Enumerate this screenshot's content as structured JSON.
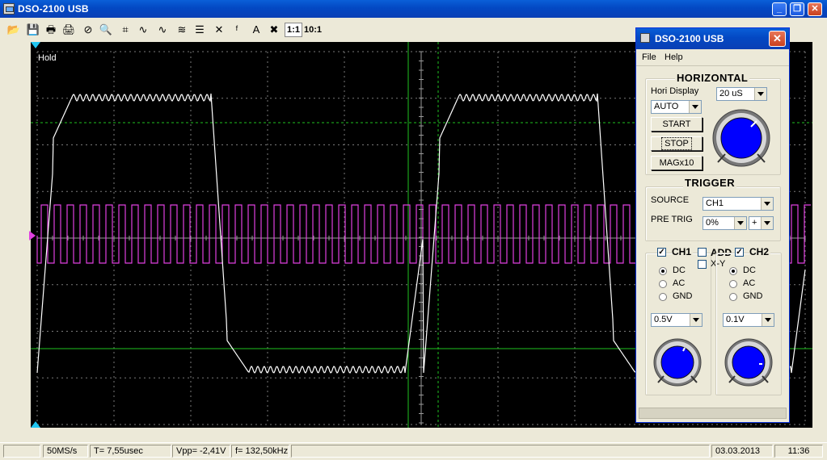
{
  "window": {
    "title": "DSO-2100 USB"
  },
  "toolbar": {
    "icons": [
      "open-icon",
      "save-icon",
      "print-icon",
      "printer-setup-icon",
      "stop-icon",
      "zoom-icon",
      "cursor-icon",
      "sine-icon",
      "sine-alt-icon",
      "math-icon",
      "grid-icon",
      "marker-icon",
      "fft-icon",
      "auto-icon",
      "clear-icon"
    ],
    "probe_1x": "1:1",
    "probe_10x": "10:1"
  },
  "screen": {
    "hold_label": "Hold",
    "colors": {
      "ch1": "#FFFFFF",
      "ch2": "#E040E0",
      "grid": "#7a7a7a",
      "cursor": "#21c221"
    }
  },
  "status": {
    "sample_rate": "50MS/s",
    "time": "T= 7,55usec",
    "vpp": "Vpp= -2,41V",
    "freq": "f= 132,50kHz",
    "date": "03.03.2013",
    "clock": "11:36"
  },
  "dialog": {
    "title": "DSO-2100 USB",
    "menu": {
      "file": "File",
      "help": "Help"
    },
    "horizontal": {
      "title": "HORIZONTAL",
      "hori_display_label": "Hori Display",
      "hori_display_value": "AUTO",
      "timebase_value": "20 uS",
      "start": "START",
      "stop": "STOP",
      "mag": "MAGx10"
    },
    "trigger": {
      "title": "TRIGGER",
      "source_label": "SOURCE",
      "source_value": "CH1",
      "pretrig_label": "PRE TRIG",
      "pretrig_value": "0%",
      "slope_value": "+"
    },
    "channels": {
      "ch1": "CH1",
      "add": "ADD",
      "ch2": "CH2",
      "xy": "X-Y",
      "dc": "DC",
      "ac": "AC",
      "gnd": "GND",
      "ch1_volts": "0.5V",
      "ch2_volts": "0.1V"
    }
  }
}
